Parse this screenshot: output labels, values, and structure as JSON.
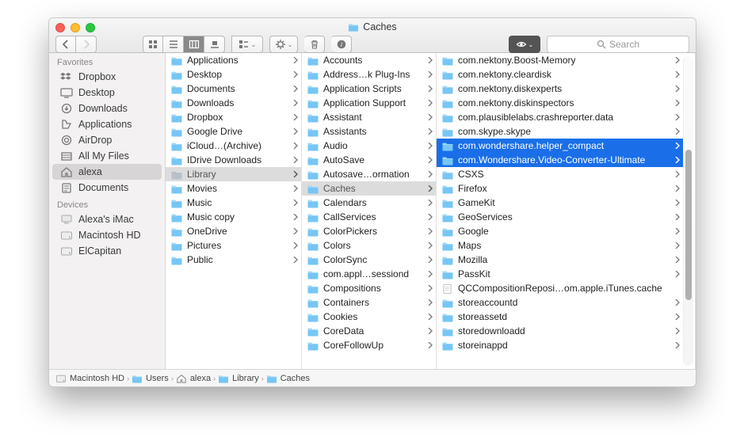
{
  "window": {
    "title": "Caches"
  },
  "search": {
    "placeholder": "Search"
  },
  "sidebar": {
    "groups": [
      {
        "label": "Favorites",
        "items": [
          {
            "icon": "dropbox",
            "label": "Dropbox"
          },
          {
            "icon": "desktop",
            "label": "Desktop"
          },
          {
            "icon": "download",
            "label": "Downloads"
          },
          {
            "icon": "app",
            "label": "Applications"
          },
          {
            "icon": "airdrop",
            "label": "AirDrop"
          },
          {
            "icon": "allfiles",
            "label": "All My Files"
          },
          {
            "icon": "home",
            "label": "alexa",
            "selected": true
          },
          {
            "icon": "doc",
            "label": "Documents"
          }
        ]
      },
      {
        "label": "Devices",
        "items": [
          {
            "icon": "imac",
            "label": "Alexa's iMac"
          },
          {
            "icon": "disk",
            "label": "Macintosh HD"
          },
          {
            "icon": "disk",
            "label": "ElCapitan"
          }
        ]
      }
    ]
  },
  "columns": [
    {
      "items": [
        {
          "label": "Applications",
          "arrow": true
        },
        {
          "label": "Desktop",
          "arrow": true
        },
        {
          "label": "Documents",
          "arrow": true
        },
        {
          "label": "Downloads",
          "arrow": true
        },
        {
          "label": "Dropbox",
          "arrow": true
        },
        {
          "label": "Google Drive",
          "arrow": true
        },
        {
          "label": "iCloud…(Archive)",
          "arrow": true
        },
        {
          "label": "IDrive Downloads",
          "arrow": true
        },
        {
          "label": "Library",
          "arrow": true,
          "selected": "gray",
          "dim": true
        },
        {
          "label": "Movies",
          "arrow": true
        },
        {
          "label": "Music",
          "arrow": true
        },
        {
          "label": "Music copy",
          "arrow": true
        },
        {
          "label": "OneDrive",
          "arrow": true
        },
        {
          "label": "Pictures",
          "arrow": true
        },
        {
          "label": "Public",
          "arrow": true
        }
      ]
    },
    {
      "items": [
        {
          "label": "Accounts",
          "arrow": true
        },
        {
          "label": "Address…k Plug-Ins",
          "arrow": true
        },
        {
          "label": "Application Scripts",
          "arrow": true
        },
        {
          "label": "Application Support",
          "arrow": true
        },
        {
          "label": "Assistant",
          "arrow": true
        },
        {
          "label": "Assistants",
          "arrow": true
        },
        {
          "label": "Audio",
          "arrow": true
        },
        {
          "label": "AutoSave",
          "arrow": true
        },
        {
          "label": "Autosave…ormation",
          "arrow": true
        },
        {
          "label": "Caches",
          "arrow": true,
          "selected": "gray"
        },
        {
          "label": "Calendars",
          "arrow": true
        },
        {
          "label": "CallServices",
          "arrow": true
        },
        {
          "label": "ColorPickers",
          "arrow": true
        },
        {
          "label": "Colors",
          "arrow": true
        },
        {
          "label": "ColorSync",
          "arrow": true
        },
        {
          "label": "com.appl…sessiond",
          "arrow": true
        },
        {
          "label": "Compositions",
          "arrow": true
        },
        {
          "label": "Containers",
          "arrow": true
        },
        {
          "label": "Cookies",
          "arrow": true
        },
        {
          "label": "CoreData",
          "arrow": true
        },
        {
          "label": "CoreFollowUp",
          "arrow": true
        }
      ]
    },
    {
      "items": [
        {
          "label": "com.nektony.Boost-Memory",
          "arrow": true
        },
        {
          "label": "com.nektony.cleardisk",
          "arrow": true
        },
        {
          "label": "com.nektony.diskexperts",
          "arrow": true
        },
        {
          "label": "com.nektony.diskinspectors",
          "arrow": true
        },
        {
          "label": "com.plausiblelabs.crashreporter.data",
          "arrow": true
        },
        {
          "label": "com.skype.skype",
          "arrow": true
        },
        {
          "label": "com.wondershare.helper_compact",
          "arrow": true,
          "selected": "blue"
        },
        {
          "label": "com.Wondershare.Video-Converter-Ultimate",
          "arrow": true,
          "selected": "blue"
        },
        {
          "label": "CSXS",
          "arrow": true
        },
        {
          "label": "Firefox",
          "arrow": true
        },
        {
          "label": "GameKit",
          "arrow": true
        },
        {
          "label": "GeoServices",
          "arrow": true
        },
        {
          "label": "Google",
          "arrow": true
        },
        {
          "label": "Maps",
          "arrow": true
        },
        {
          "label": "Mozilla",
          "arrow": true
        },
        {
          "label": "PassKit",
          "arrow": true
        },
        {
          "label": "QCCompositionReposi…om.apple.iTunes.cache",
          "arrow": false,
          "type": "file"
        },
        {
          "label": "storeaccountd",
          "arrow": true
        },
        {
          "label": "storeassetd",
          "arrow": true
        },
        {
          "label": "storedownloadd",
          "arrow": true
        },
        {
          "label": "storeinappd",
          "arrow": true
        }
      ]
    }
  ],
  "pathbar": [
    {
      "icon": "disk",
      "label": "Macintosh HD"
    },
    {
      "icon": "folder",
      "label": "Users"
    },
    {
      "icon": "home",
      "label": "alexa"
    },
    {
      "icon": "folder",
      "label": "Library"
    },
    {
      "icon": "folder",
      "label": "Caches"
    }
  ]
}
